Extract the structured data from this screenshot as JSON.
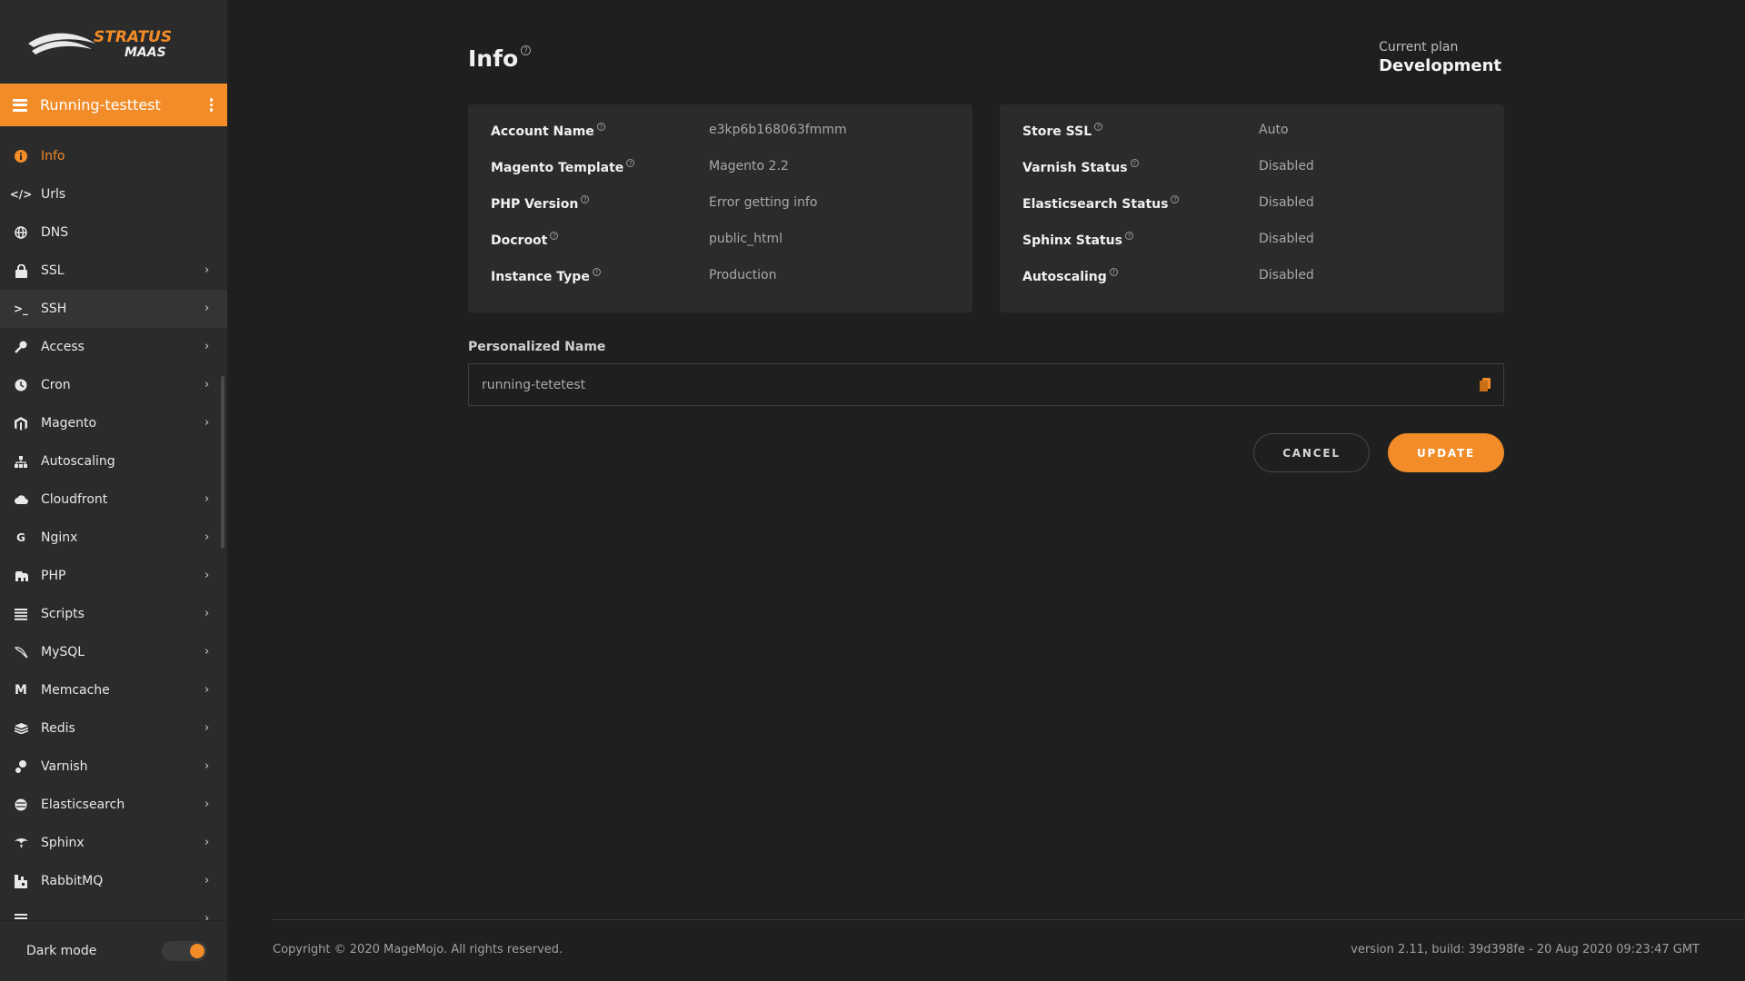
{
  "logo": {
    "line1": "STRATUS",
    "line2": "MAAS"
  },
  "instance": {
    "name": "Running-testtest"
  },
  "nav": [
    {
      "label": "Info",
      "icon": "info-icon",
      "active": true,
      "chevron": false
    },
    {
      "label": "Urls",
      "icon": "code-icon",
      "chevron": false
    },
    {
      "label": "DNS",
      "icon": "globe-icon",
      "chevron": false
    },
    {
      "label": "SSL",
      "icon": "lock-icon",
      "chevron": true
    },
    {
      "label": "SSH",
      "icon": "terminal-icon",
      "chevron": true,
      "hover": true
    },
    {
      "label": "Access",
      "icon": "key-icon",
      "chevron": true
    },
    {
      "label": "Cron",
      "icon": "clock-icon",
      "chevron": true
    },
    {
      "label": "Magento",
      "icon": "magento-icon",
      "chevron": true
    },
    {
      "label": "Autoscaling",
      "icon": "sitemap-icon",
      "chevron": false
    },
    {
      "label": "Cloudfront",
      "icon": "cloud-icon",
      "chevron": true
    },
    {
      "label": "Nginx",
      "icon": "nginx-icon",
      "chevron": true
    },
    {
      "label": "PHP",
      "icon": "php-icon",
      "chevron": true
    },
    {
      "label": "Scripts",
      "icon": "list-icon",
      "chevron": true
    },
    {
      "label": "MySQL",
      "icon": "mysql-icon",
      "chevron": true
    },
    {
      "label": "Memcache",
      "icon": "memcache-icon",
      "chevron": true
    },
    {
      "label": "Redis",
      "icon": "redis-icon",
      "chevron": true
    },
    {
      "label": "Varnish",
      "icon": "varnish-icon",
      "chevron": true
    },
    {
      "label": "Elasticsearch",
      "icon": "elasticsearch-icon",
      "chevron": true
    },
    {
      "label": "Sphinx",
      "icon": "sphinx-icon",
      "chevron": true
    },
    {
      "label": "RabbitMQ",
      "icon": "rabbitmq-icon",
      "chevron": true
    }
  ],
  "dark_mode": {
    "label": "Dark mode",
    "on": true
  },
  "page": {
    "title": "Info",
    "help": "?"
  },
  "plan": {
    "label": "Current plan",
    "value": "Development"
  },
  "left_card": [
    {
      "key": "Account Name",
      "value": "e3kp6b168063fmmm"
    },
    {
      "key": "Magento Template",
      "value": "Magento 2.2"
    },
    {
      "key": "PHP Version",
      "value": "Error getting info"
    },
    {
      "key": "Docroot",
      "value": "public_html"
    },
    {
      "key": "Instance Type",
      "value": "Production"
    }
  ],
  "right_card": [
    {
      "key": "Store SSL",
      "value": "Auto"
    },
    {
      "key": "Varnish Status",
      "value": "Disabled"
    },
    {
      "key": "Elasticsearch Status",
      "value": "Disabled"
    },
    {
      "key": "Sphinx Status",
      "value": "Disabled"
    },
    {
      "key": "Autoscaling",
      "value": "Disabled"
    }
  ],
  "personalized": {
    "label": "Personalized Name",
    "value": "running-tetetest"
  },
  "buttons": {
    "cancel": "CANCEL",
    "update": "UPDATE"
  },
  "footer": {
    "copyright": "Copyright © 2020 MageMojo. All rights reserved.",
    "version": "version 2.11, build: 39d398fe - 20 Aug 2020 09:23:47 GMT"
  },
  "colors": {
    "accent": "#f28c28",
    "background": "#1f1f1f",
    "sidebar": "#2b2b2b",
    "card": "#2b2b2b"
  }
}
